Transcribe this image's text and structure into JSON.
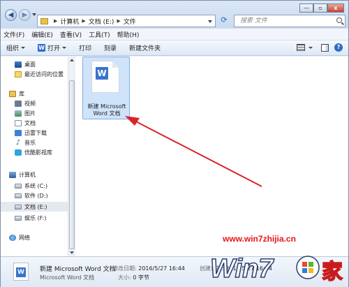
{
  "address": {
    "crumbs": [
      "计算机",
      "文档 (E:)",
      "文件"
    ]
  },
  "search": {
    "placeholder": "搜索 文件"
  },
  "window_controls": [
    "—",
    "▫",
    "x"
  ],
  "menu": [
    "文件(F)",
    "编辑(E)",
    "查看(V)",
    "工具(T)",
    "帮助(H)"
  ],
  "toolbar": {
    "organize": "组织",
    "open": "打开",
    "print": "打印",
    "burn": "刻录",
    "new_folder": "新建文件夹"
  },
  "nav": {
    "items": [
      {
        "label": "桌面",
        "icon": "desktop-icon"
      },
      {
        "label": "最近访问的位置",
        "icon": "recent-places-icon"
      },
      {
        "label": "库",
        "icon": "library-icon"
      },
      {
        "label": "视频",
        "icon": "video-icon"
      },
      {
        "label": "图片",
        "icon": "picture-icon"
      },
      {
        "label": "文档",
        "icon": "document-icon"
      },
      {
        "label": "迅雷下载",
        "icon": "xunlei-icon"
      },
      {
        "label": "音乐",
        "icon": "music-icon"
      },
      {
        "label": "优酷影视库",
        "icon": "youku-icon"
      },
      {
        "label": "计算机",
        "icon": "computer-icon"
      },
      {
        "label": "系统 (C:)",
        "icon": "drive-icon"
      },
      {
        "label": "软件 (D:)",
        "icon": "drive-icon"
      },
      {
        "label": "文档 (E:)",
        "icon": "drive-icon",
        "selected": true
      },
      {
        "label": "娱乐 (F:)",
        "icon": "drive-icon"
      },
      {
        "label": "网络",
        "icon": "network-icon"
      }
    ]
  },
  "file": {
    "name_line1": "新建 Microsoft",
    "name_line2": "Word 文档",
    "badge": "W"
  },
  "details": {
    "name": "新建 Microsoft Word 文档",
    "type": "Microsoft Word 文档",
    "modified_key": "修改日期:",
    "modified_val": "2016/5/27 16:44",
    "size_key": "大小:",
    "size_val": "0 字节",
    "created_key": "创建日期:",
    "created_val": "2016/5/27 16:44"
  },
  "watermark": {
    "url": "www.win7zhijia.cn",
    "logo_text": "Win7",
    "logo_suffix": "家"
  },
  "colors": {
    "accent_red": "#e3161a",
    "selection": "#cfe3fb",
    "wps_blue": "#3b73cc"
  }
}
